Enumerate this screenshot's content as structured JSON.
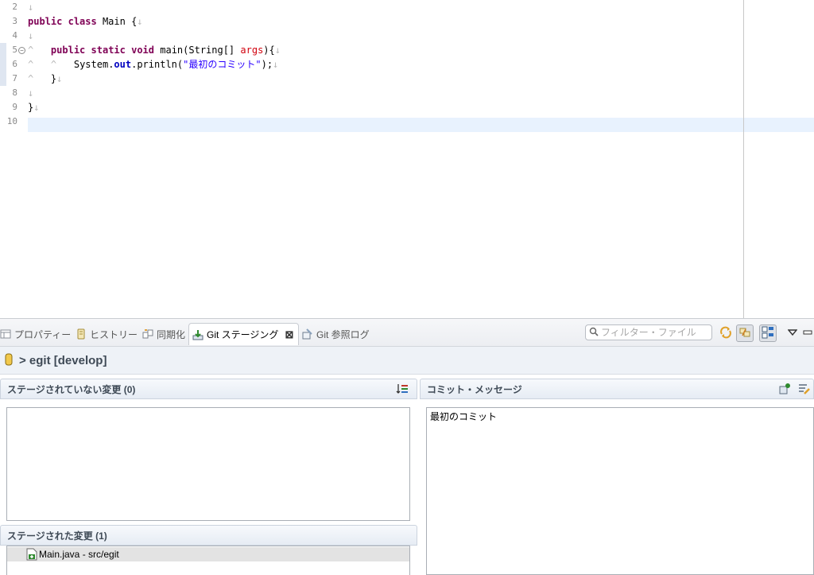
{
  "editor": {
    "line_numbers": [
      "2",
      "3",
      "4",
      "5",
      "6",
      "7",
      "8",
      "9",
      "10"
    ],
    "code": {
      "l3_kw1": "public",
      "l3_kw2": "class",
      "l3_rest": " Main {",
      "l5_kw1": "public",
      "l5_kw2": "static",
      "l5_kw3": "void",
      "l5_mid": " main(String[] ",
      "l5_param": "args",
      "l5_end": "){",
      "l6_pre": "System.",
      "l6_field": "out",
      "l6_mid": ".println(",
      "l6_str": "\"最初のコミット\"",
      "l6_end": ");",
      "l7_text": "}",
      "l9_text": "}"
    },
    "whitespace_glyphs": {
      "newline": "↓",
      "tab": "^"
    },
    "fold_glyph": "−"
  },
  "tabs": [
    {
      "label": "プロパティー",
      "icon": "properties-icon"
    },
    {
      "label": "ヒストリー",
      "icon": "history-icon"
    },
    {
      "label": "同期化",
      "icon": "synchronize-icon"
    },
    {
      "label": "Git ステージング",
      "icon": "git-staging-icon",
      "active": true
    },
    {
      "label": "Git 参照ログ",
      "icon": "git-reflog-icon"
    }
  ],
  "tab_close_glyph": "⊠",
  "filter": {
    "placeholder": "フィルター・ファイル"
  },
  "repo": {
    "title": "> egit [develop]"
  },
  "unstaged": {
    "header": "ステージされていない変更 (0)",
    "files": []
  },
  "staged": {
    "header": "ステージされた変更 (1)",
    "files": [
      {
        "label": "Main.java - src/egit"
      }
    ]
  },
  "commit": {
    "header": "コミット・メッセージ",
    "message": "最初のコミット"
  },
  "colors": {
    "keyword": "#7f0055",
    "string": "#2a00ff",
    "field": "#0000c0",
    "parameter": "#d1000d",
    "current_line": "#e8f2fe"
  }
}
